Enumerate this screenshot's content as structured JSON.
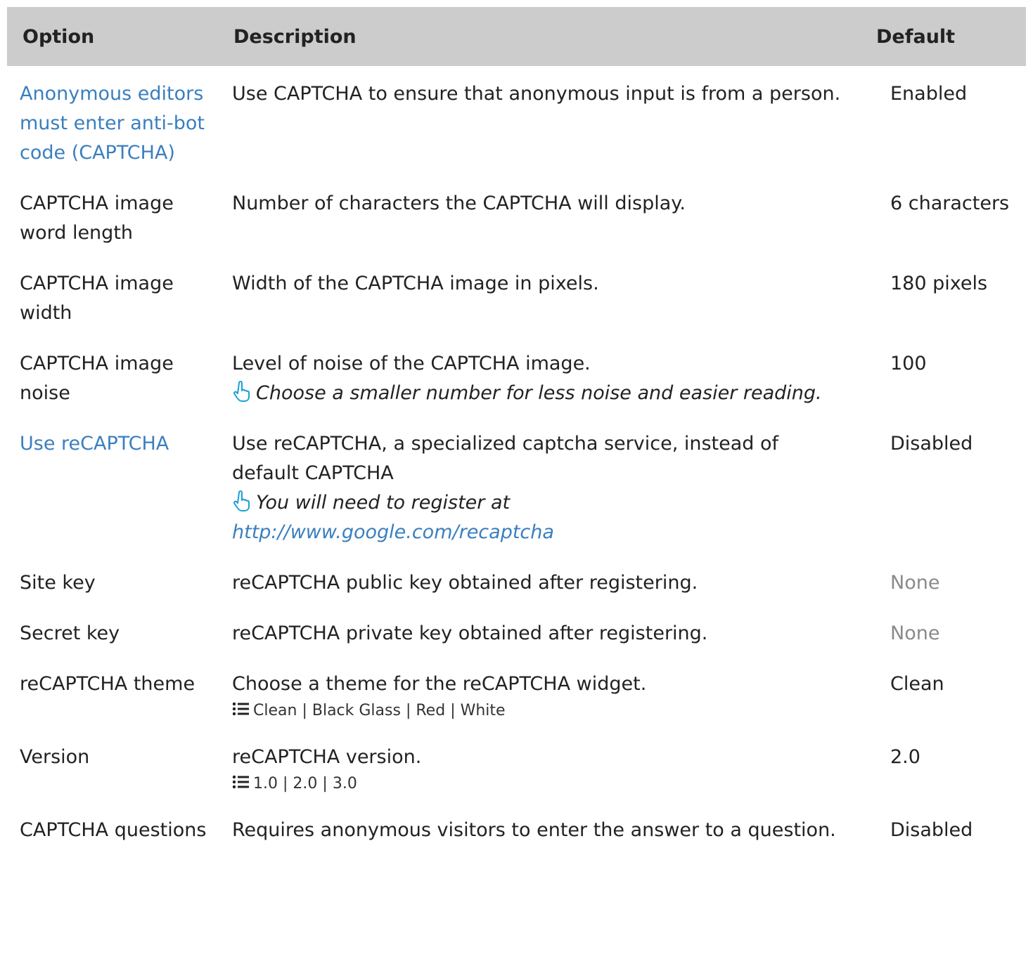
{
  "header": {
    "option": "Option",
    "description": "Description",
    "default": "Default"
  },
  "rows": [
    {
      "option": "Anonymous editors must enter anti-bot code (CAPTCHA)",
      "option_is_link": true,
      "description": "Use CAPTCHA to ensure that anonymous input is from a person.",
      "default": "Enabled"
    },
    {
      "option": "CAPTCHA image word length",
      "description": "Number of characters the CAPTCHA will display.",
      "default": "6 characters"
    },
    {
      "option": "CAPTCHA image width",
      "description": "Width of the CAPTCHA image in pixels.",
      "default": "180 pixels"
    },
    {
      "option": "CAPTCHA image noise",
      "description": "Level of noise of the CAPTCHA image.",
      "tip": "Choose a smaller number for less noise and easier reading.",
      "default": "100"
    },
    {
      "option": "Use reCAPTCHA",
      "option_is_link": true,
      "description": "Use reCAPTCHA, a specialized captcha service, instead of default CAPTCHA",
      "tip": "You will need to register at",
      "tip_link": "http://www.google.com/recaptcha",
      "default": "Disabled"
    },
    {
      "option": "Site key",
      "description": "reCAPTCHA public key obtained after registering.",
      "default": "None"
    },
    {
      "option": "Secret key",
      "description": "reCAPTCHA private key obtained after registering.",
      "default": "None"
    },
    {
      "option": "reCAPTCHA theme",
      "description": "Choose a theme for the reCAPTCHA widget.",
      "choices": [
        "Clean",
        "Black Glass",
        "Red",
        "White"
      ],
      "default": "Clean"
    },
    {
      "option": "Version",
      "description": "reCAPTCHA version.",
      "choices": [
        "1.0",
        "2.0",
        "3.0"
      ],
      "default": "2.0"
    },
    {
      "option": "CAPTCHA questions",
      "description": "Requires anonymous visitors to enter the answer to a question.",
      "default": "Disabled"
    }
  ],
  "colors": {
    "header_bg": "#cccccc",
    "link": "#3a7fbf",
    "muted": "#8a8a8a",
    "tip_icon": "#1aa0d8"
  },
  "icons": {
    "tip": "pointing-hand-icon",
    "choices": "list-icon"
  }
}
